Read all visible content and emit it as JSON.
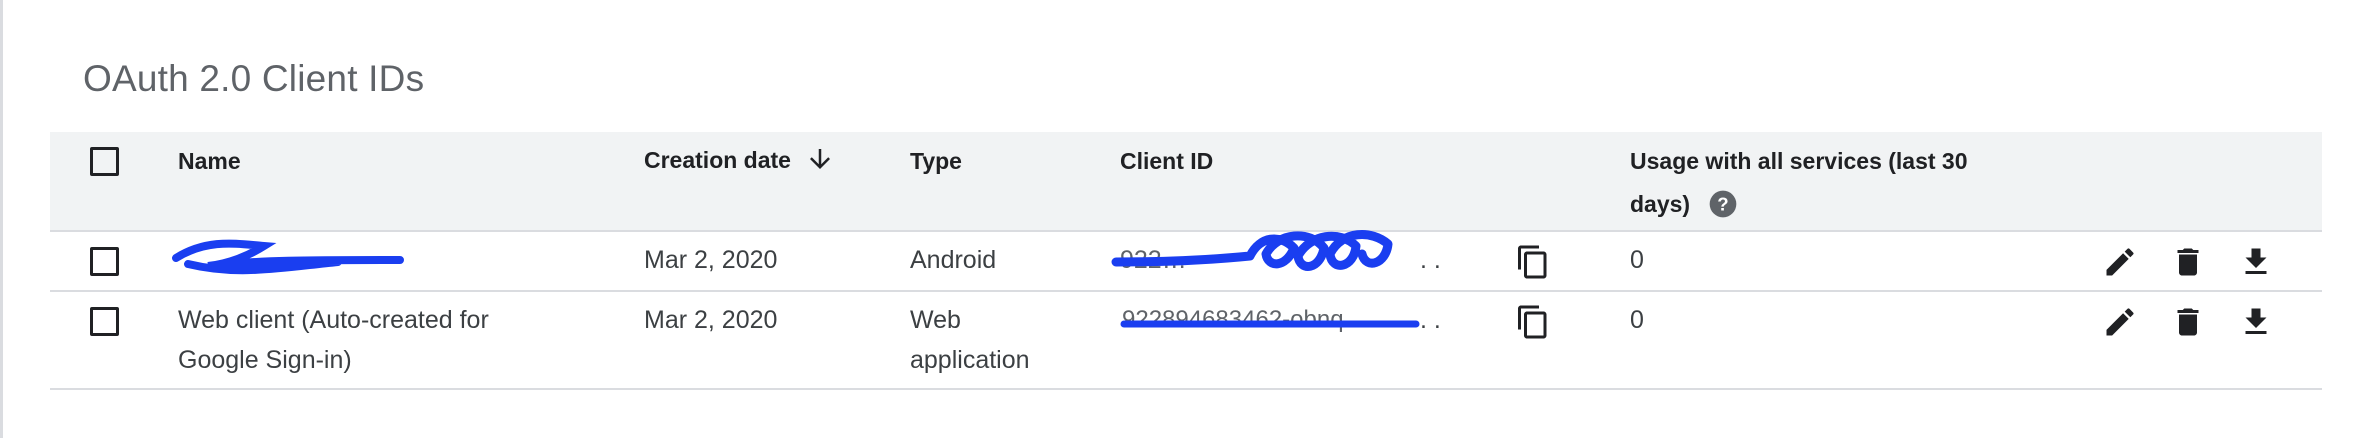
{
  "section": {
    "title": "OAuth 2.0 Client IDs"
  },
  "table": {
    "columns": {
      "name": "Name",
      "creation_date": "Creation date",
      "type": "Type",
      "client_id": "Client ID",
      "usage_line1": "Usage with all services (last 30",
      "usage_line2": "days)"
    },
    "sort": {
      "column": "creation_date",
      "direction": "descending",
      "icon": "arrow-down-icon"
    },
    "rows": [
      {
        "name": "",
        "creation_date": "Mar 2, 2020",
        "type": "Android",
        "type_line2": "",
        "client_id": "922…",
        "client_id_ellipsis": ". .",
        "usage": "0",
        "redacted": true
      },
      {
        "name": "Web client (Auto-created for",
        "name_line2": "Google Sign-in)",
        "creation_date": "Mar 2, 2020",
        "type": "Web",
        "type_line2": "application",
        "client_id": "922894683462-obnq",
        "client_id_ellipsis": ". .",
        "usage": "0",
        "redacted": true
      }
    ],
    "row_icons": [
      "copy-icon",
      "edit-icon",
      "delete-icon",
      "download-icon"
    ]
  },
  "colors": {
    "header_bg": "#f1f3f4",
    "border": "#dadce0",
    "redaction_ink": "#1a3ef0",
    "help_icon": "#5f6368"
  }
}
